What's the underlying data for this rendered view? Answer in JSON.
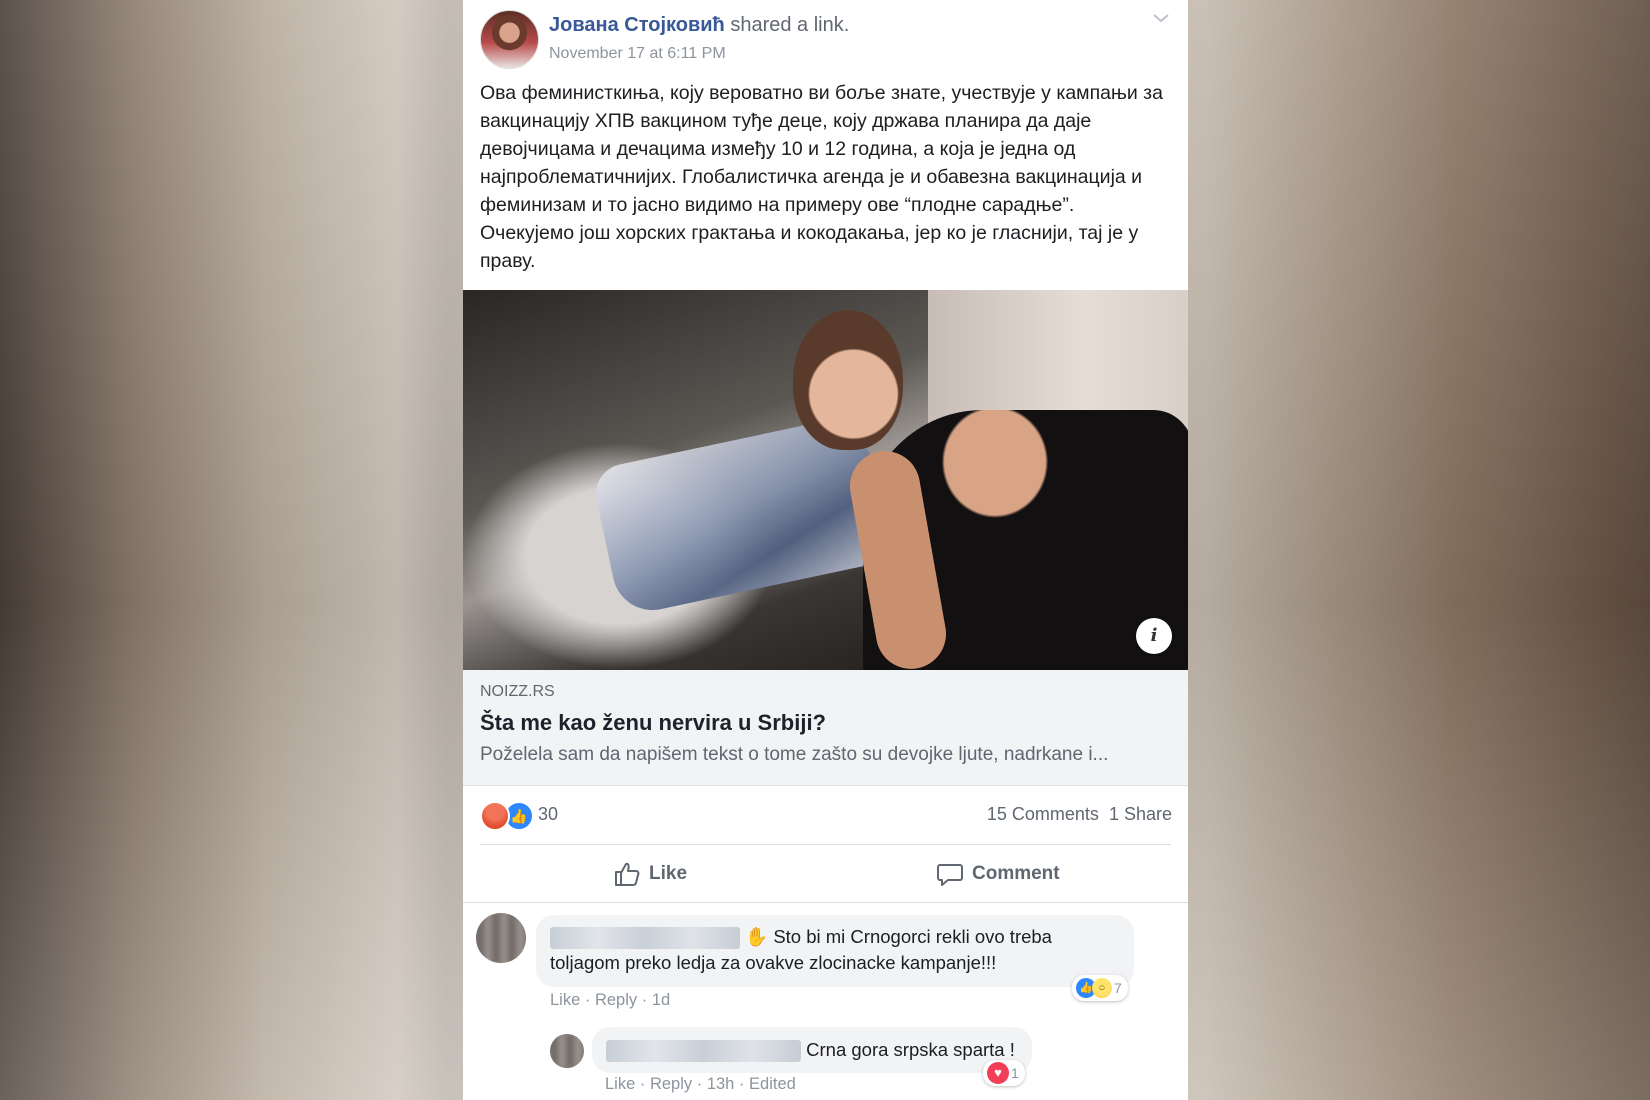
{
  "post": {
    "author": "Јована Стојковић",
    "action": "shared a link.",
    "timestamp": "November 17 at 6:11 PM",
    "text": "Ова феминисткиња, коју вероватно ви боље знате, учествује у кампањи за вакцинацију ХПВ вакцином туђе деце, коју држава планира да даје девојчицама и дечацима између 10 и 12 година, а која је једна од најпроблематичнијих. Глобалистичка агенда је и обавезна вакцинација и феминизам и то јасно видимо на примеру ове “плодне сарадње”. Очекујемо још хорских грактања и кокодакања, јер ко је гласнији, тај је у праву."
  },
  "link": {
    "domain": "NOIZZ.RS",
    "title": "Šta me kao ženu nervira u Srbiji?",
    "description": "Poželela sam da napišem tekst o tome zašto su devojke ljute, nadrkane i...",
    "info_icon": "info-icon"
  },
  "stats": {
    "reactions_count": "30",
    "reaction_icons": [
      "angry",
      "like"
    ],
    "comments": "15 Comments",
    "shares": "1 Share"
  },
  "actions": {
    "like": "Like",
    "comment": "Comment"
  },
  "comments": [
    {
      "emoji": "✋",
      "text_line1": "Sto bi mi Crnogorci rekli ovo treba",
      "text_line2": "toljagom preko ledja za ovakve zlocinacke kampanje!!!",
      "like": "Like",
      "reply": "Reply",
      "time": "1d",
      "reaction_icons": [
        "like",
        "wow"
      ],
      "reaction_count": "7"
    },
    {
      "text": "Crna gora srpska sparta !",
      "like": "Like",
      "reply": "Reply",
      "time": "13h",
      "edited": "Edited",
      "reaction_icons": [
        "love"
      ],
      "reaction_count": "1"
    }
  ],
  "colors": {
    "author_link": "#385898",
    "meta_text": "#606770",
    "like_blue": "#2d88ff",
    "angry": "#e24c2c",
    "love": "#f33e58"
  }
}
